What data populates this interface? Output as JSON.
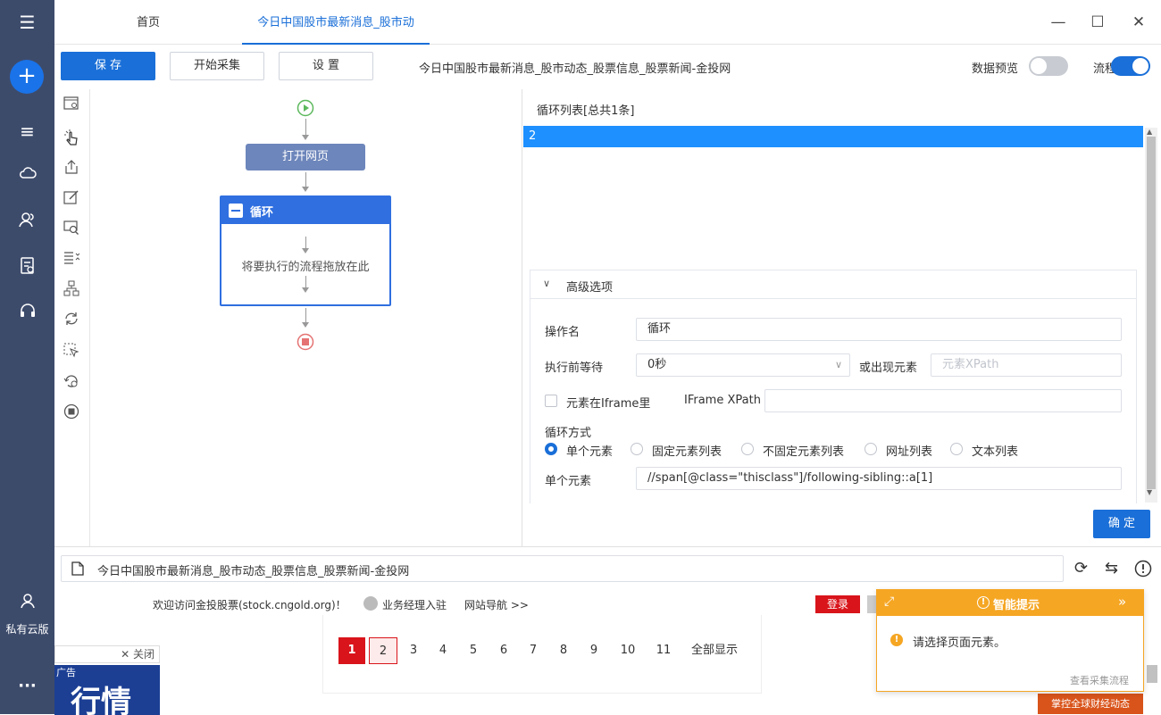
{
  "sidebar": {
    "bottom_label": "私有云版"
  },
  "tabs": [
    {
      "label": "首页"
    },
    {
      "label": "今日中国股市最新消息_股市动"
    }
  ],
  "toolbar": {
    "save": "保 存",
    "start": "开始采集",
    "settings": "设 置",
    "page_title": "今日中国股市最新消息_股市动态_股票信息_股票新闻-金投网",
    "preview_label": "数据预览",
    "flow_label": "流程"
  },
  "flow": {
    "open_page": "打开网页",
    "loop_title": "循环",
    "drop_hint": "将要执行的流程拖放在此"
  },
  "loop_list": {
    "header": "循环列表[总共1条]",
    "items": [
      "2"
    ]
  },
  "advanced": {
    "title": "高级选项",
    "op_name_label": "操作名",
    "op_name_value": "循环",
    "wait_label": "执行前等待",
    "wait_value": "0秒",
    "or_appear_label": "或出现元素",
    "xpath_placeholder": "元素XPath",
    "iframe_label": "元素在Iframe里",
    "iframe_xpath_label": "IFrame XPath",
    "loop_mode_label": "循环方式",
    "modes": [
      "单个元素",
      "固定元素列表",
      "不固定元素列表",
      "网址列表",
      "文本列表"
    ],
    "single_element_label": "单个元素",
    "single_element_value": "//span[@class=\"thisclass\"]/following-sibling::a[1]"
  },
  "confirm": "确 定",
  "browser": {
    "address": "今日中国股市最新消息_股市动态_股票信息_股票新闻-金投网",
    "welcome": "欢迎访问金投股票(stock.cngold.org)！",
    "manager": "业务经理入驻",
    "nav": "网站导航 >>",
    "login": "登录",
    "close_ad": "✕ 关闭",
    "ad_tag": "广告",
    "ad_text": "行情",
    "pages": [
      "1",
      "2",
      "3",
      "4",
      "5",
      "6",
      "7",
      "8",
      "9",
      "10",
      "11"
    ],
    "show_all": "全部显示",
    "bottom_banner": "掌控全球财经动态"
  },
  "smart_tip": {
    "title": "智能提示",
    "message": "请选择页面元素。",
    "link": "查看采集流程"
  },
  "colors": {
    "accent": "#1a6fd8",
    "sidebar": "#3d4b6b",
    "tip": "#f5a623",
    "loop_header": "#2f6fe0",
    "open_node": "#6d86bb"
  }
}
